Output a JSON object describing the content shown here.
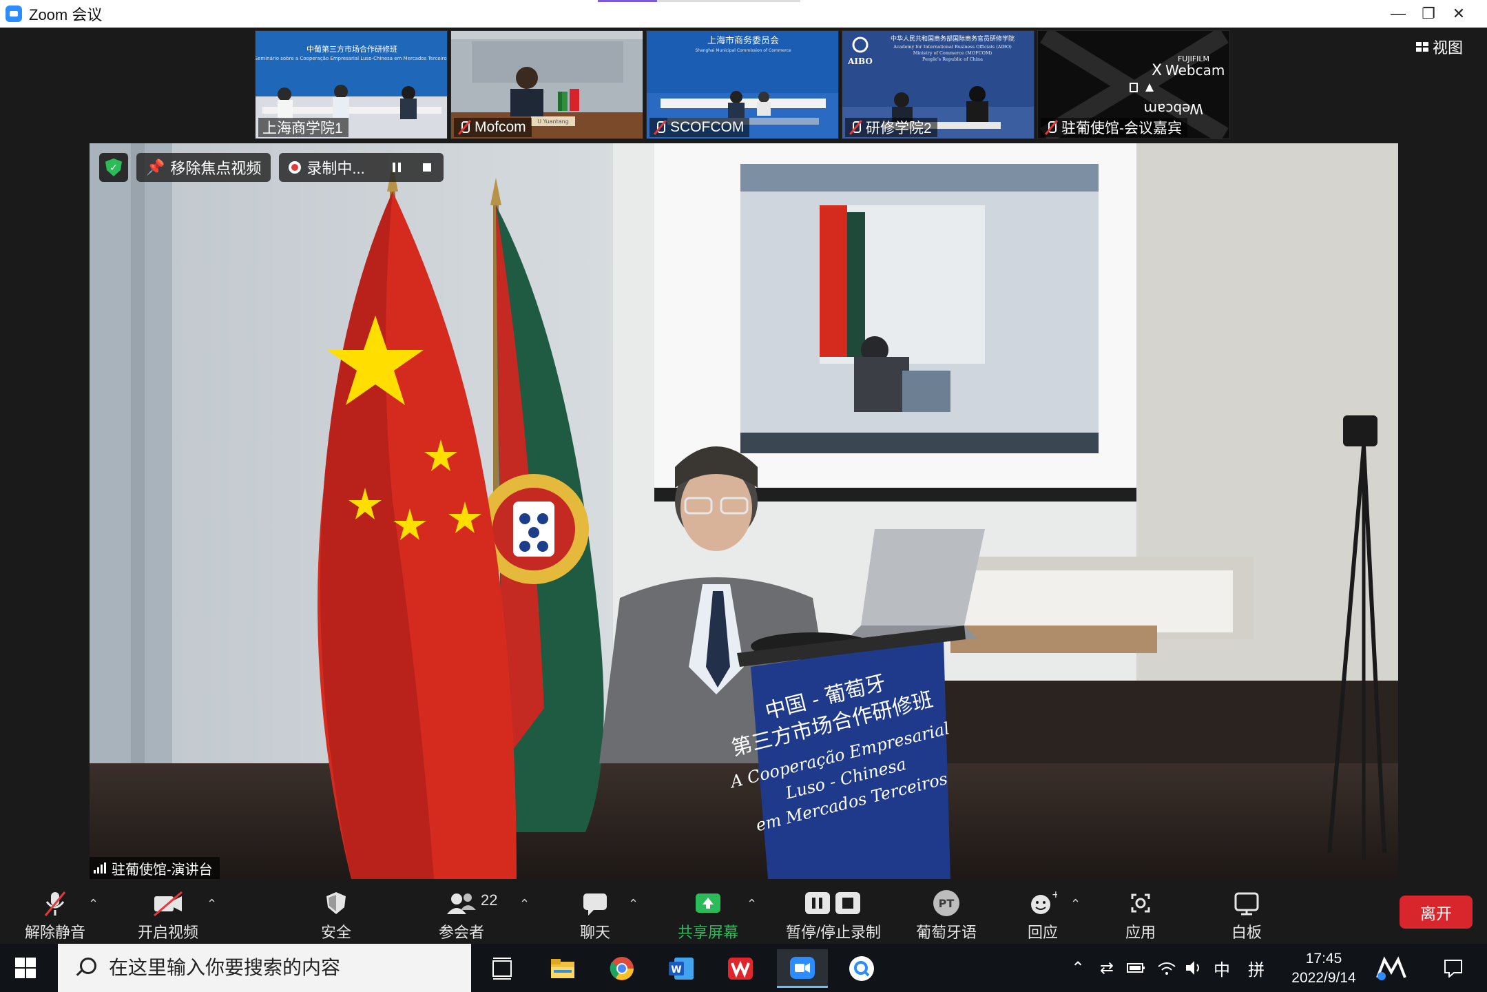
{
  "window": {
    "title": "Zoom 会议",
    "controls": {
      "minimize": "—",
      "restore": "❐",
      "close": "✕"
    }
  },
  "thumbnails": [
    {
      "name": "上海商学院1",
      "muted": false
    },
    {
      "name": "Mofcom",
      "muted": true
    },
    {
      "name": "SCOFCOM",
      "muted": true
    },
    {
      "name": "研修学院2",
      "muted": true
    },
    {
      "name": "驻葡使馆-会议嘉宾",
      "muted": true
    }
  ],
  "thumb_text": {
    "t1_title": "中葡第三方市场合作研修班",
    "t1_sub": "Seminário sobre a Cooperação Empresarial Luso-Chinesa em Mercados Terceiros",
    "t2_nameplate": "U Yuantang",
    "t3_title": "上海市商务委员会",
    "t3_sub": "Shanghai Municipal Commission of Commerce",
    "t4_logo": "AIBO",
    "t4_title": "中华人民共和国商务部国际商务官员研修学院",
    "t4_sub1": "Academy for International Business Officials (AIBO)",
    "t4_sub2": "Ministry of Commerce (MOFCOM)",
    "t4_sub3": "People's Republic of China",
    "t5_brand": "FUJIFILM",
    "t5_product": "Webcam"
  },
  "view_button": "视图",
  "main_video": {
    "unpin_label": "移除焦点视频",
    "recording_label": "录制中...",
    "speaker_name": "驻葡使馆-演讲台",
    "podium_line1": "中国 - 葡萄牙",
    "podium_line2": "第三方市场合作研修班",
    "podium_line3": "A Cooperação Empresarial",
    "podium_line4": "Luso - Chinesa",
    "podium_line5": "em Mercados Terceiros"
  },
  "toolbar": {
    "unmute": "解除静音",
    "start_video": "开启视频",
    "security": "安全",
    "participants": "参会者",
    "participants_count": "22",
    "chat": "聊天",
    "share_screen": "共享屏幕",
    "pause_stop_recording": "暂停/停止录制",
    "interpretation": "葡萄牙语",
    "interpretation_badge": "PT",
    "reactions": "回应",
    "apps": "应用",
    "whiteboard": "白板",
    "leave": "离开"
  },
  "taskbar": {
    "search_placeholder": "在这里输入你要搜索的内容",
    "tray_ime_lang": "中",
    "tray_ime_mode": "拼",
    "time": "17:45",
    "date": "2022/9/14"
  },
  "colors": {
    "accent_green": "#2cbb59",
    "leave_red": "#d9262c",
    "zoom_blue": "#2d8cff",
    "mute_red": "#e5383b"
  }
}
